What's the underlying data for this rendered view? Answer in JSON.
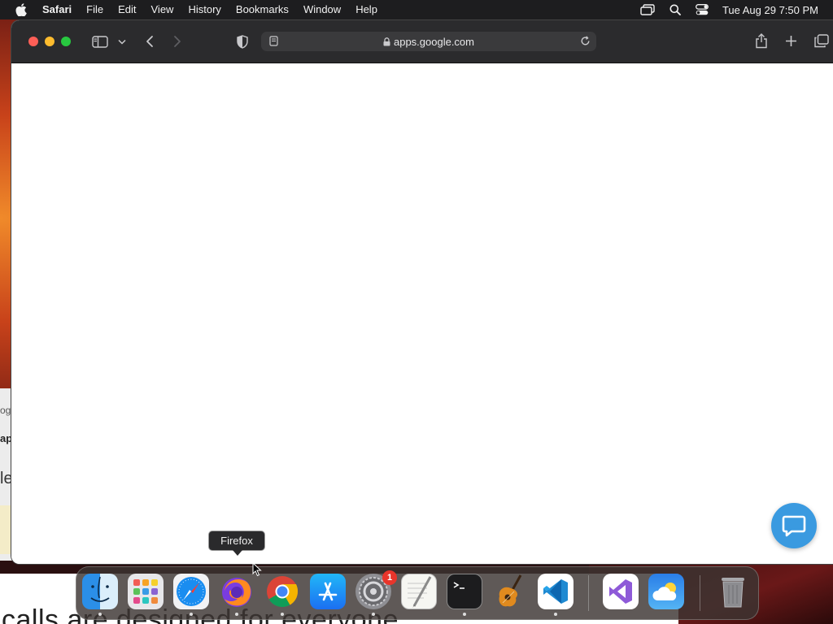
{
  "menubar": {
    "app_name": "Safari",
    "items": [
      "File",
      "Edit",
      "View",
      "History",
      "Bookmarks",
      "Window",
      "Help"
    ],
    "clock": "Tue Aug 29  7:50 PM"
  },
  "browser": {
    "url": "apps.google.com"
  },
  "background": {
    "peek_text_1": "ogl",
    "peek_text_2": "app",
    "peek_text_3": "le",
    "bottom_text": "calls are designed for everyone"
  },
  "tooltip": {
    "label": "Firefox"
  },
  "dock": {
    "badge_count": "1",
    "apps": [
      "finder",
      "launchpad",
      "safari",
      "firefox",
      "chrome",
      "app-store",
      "system-settings",
      "textedit",
      "terminal",
      "garageband",
      "vscode",
      "visual-studio",
      "weather",
      "trash"
    ]
  },
  "colors": {
    "menubar_bg": "#1d1d1f",
    "toolbar_bg": "#2b2b2d",
    "chat_button": "#3a9ae0",
    "badge": "#e8352b"
  }
}
